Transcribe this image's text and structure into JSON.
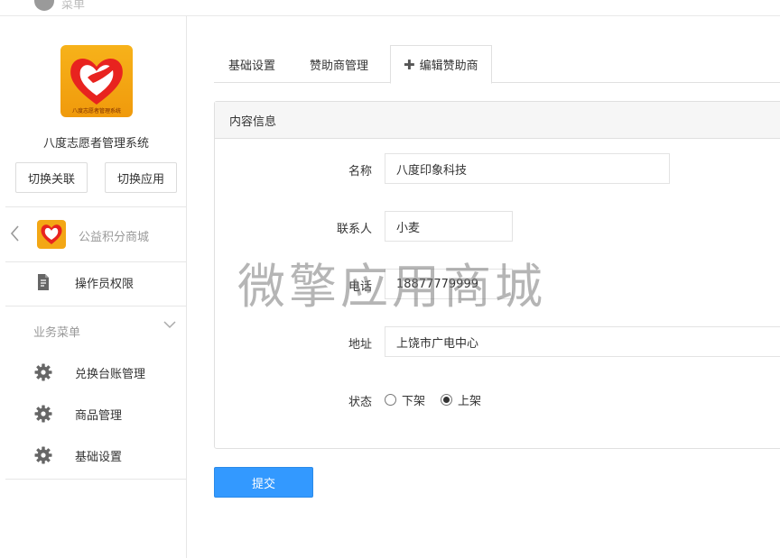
{
  "topbar": {
    "label": "菜单"
  },
  "sidebar": {
    "logo_caption": "八度志愿者管理系统",
    "app_name": "八度志愿者管理系统",
    "switch_link_label": "切换关联",
    "switch_app_label": "切换应用",
    "mall_name": "公益积分商城",
    "operator_permission": "操作员权限",
    "group_title": "业务菜单",
    "items": [
      {
        "label": "兑换台账管理",
        "icon": "gear-icon"
      },
      {
        "label": "商品管理",
        "icon": "gear-icon"
      },
      {
        "label": "基础设置",
        "icon": "gear-icon"
      }
    ]
  },
  "tabs": [
    {
      "label": "基础设置"
    },
    {
      "label": "赞助商管理"
    },
    {
      "label": "编辑赞助商",
      "icon": "plus-icon",
      "active": true
    }
  ],
  "panel": {
    "title": "内容信息",
    "fields": {
      "name": {
        "label": "名称",
        "value": "八度印象科技"
      },
      "contact": {
        "label": "联系人",
        "value": "小麦"
      },
      "phone": {
        "label": "电话",
        "value": "18877779999"
      },
      "address": {
        "label": "地址",
        "value": "上饶市广电中心"
      }
    },
    "status": {
      "label": "状态",
      "options": [
        {
          "label": "下架",
          "selected": false
        },
        {
          "label": "上架",
          "selected": true
        }
      ]
    }
  },
  "submit_label": "提交",
  "watermark": "微擎应用商城",
  "colors": {
    "primary": "#3399ff",
    "logo": "#f3a715",
    "heart": "#e8231f"
  }
}
